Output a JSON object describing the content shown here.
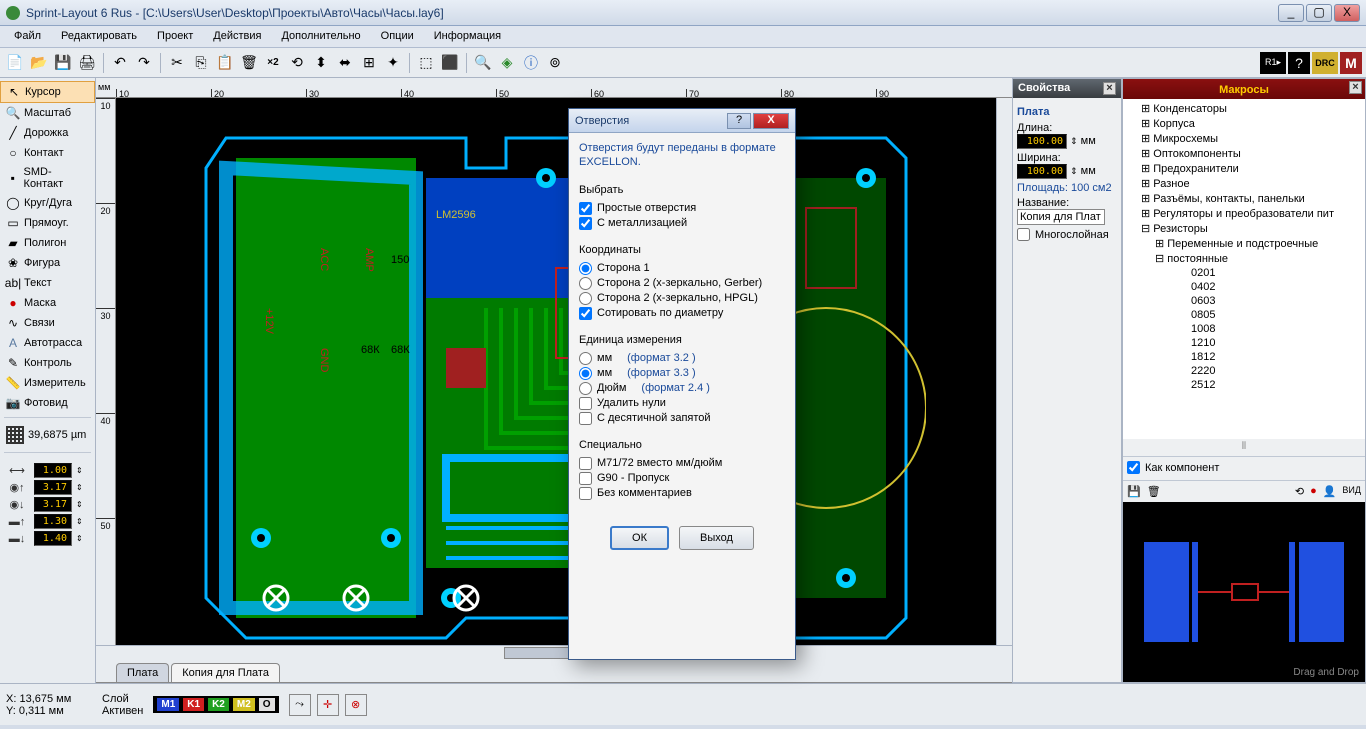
{
  "window": {
    "title": "Sprint-Layout 6 Rus - [C:\\Users\\User\\Desktop\\Проекты\\Авто\\Часы\\Часы.lay6]",
    "min": "_",
    "max": "▢",
    "close": "X"
  },
  "menu": [
    "Файл",
    "Редактировать",
    "Проект",
    "Действия",
    "Дополнительно",
    "Опции",
    "Информация"
  ],
  "tools_left": [
    {
      "icon": "↖",
      "label": "Курсор",
      "sel": true
    },
    {
      "icon": "🔍",
      "label": "Масштаб"
    },
    {
      "icon": "╱",
      "label": "Дорожка"
    },
    {
      "icon": "○",
      "label": "Контакт"
    },
    {
      "icon": "▪",
      "label": "SMD-Контакт"
    },
    {
      "icon": "◯",
      "label": "Круг/Дуга"
    },
    {
      "icon": "▭",
      "label": "Прямоуг."
    },
    {
      "icon": "▰",
      "label": "Полигон"
    },
    {
      "icon": "❀",
      "label": "Фигура"
    },
    {
      "icon": "ab|",
      "label": "Текст"
    },
    {
      "icon": "●",
      "label": "Маска",
      "color": "#c00"
    },
    {
      "icon": "∿",
      "label": "Связи"
    },
    {
      "icon": "A",
      "label": "Автотрасса",
      "color": "#5a7aa0"
    },
    {
      "icon": "✎",
      "label": "Контроль"
    },
    {
      "icon": "📏",
      "label": "Измеритель"
    },
    {
      "icon": "📷",
      "label": "Фотовид"
    }
  ],
  "grid_value": "39,6875 µm",
  "track_params": [
    {
      "icon": "⟷",
      "val": "1.00"
    },
    {
      "icon": "◉↑",
      "val": "3.17"
    },
    {
      "icon": "◉↓",
      "val": "3.17"
    },
    {
      "icon": "▬↑",
      "val": "1.30"
    },
    {
      "icon": "▬↓",
      "val": "1.40"
    }
  ],
  "ruler_h": {
    "unit": "мм",
    "ticks": [
      "10",
      "20",
      "30",
      "40",
      "50",
      "60",
      "70",
      "80",
      "90"
    ]
  },
  "ruler_v": {
    "ticks": [
      "10",
      "20",
      "30",
      "40",
      "50"
    ]
  },
  "canvas_tabs": [
    {
      "label": "Плата",
      "active": false
    },
    {
      "label": "Копия для Плата",
      "active": true
    }
  ],
  "properties": {
    "header": "Свойства",
    "section1": "Плата",
    "length_lbl": "Длина:",
    "length_val": "100.00",
    "length_unit": "мм",
    "width_lbl": "Ширина:",
    "width_val": "100.00",
    "width_unit": "мм",
    "area_lbl": "Площадь:",
    "area_val": "100 см2",
    "name_lbl": "Название:",
    "name_val": "Копия для Плат",
    "multilayer_lbl": "Многослойная"
  },
  "macros": {
    "header": "Макросы",
    "tree": [
      {
        "t": "⊞ Конденсаторы",
        "lvl": 1
      },
      {
        "t": "⊞ Корпуса",
        "lvl": 1
      },
      {
        "t": "⊞ Микросхемы",
        "lvl": 1
      },
      {
        "t": "⊞ Оптокомпоненты",
        "lvl": 1
      },
      {
        "t": "⊞ Предохранители",
        "lvl": 1
      },
      {
        "t": "⊞ Разное",
        "lvl": 1
      },
      {
        "t": "⊞ Разъёмы, контакты, панельки",
        "lvl": 1
      },
      {
        "t": "⊞ Регуляторы и преобразователи пит",
        "lvl": 1
      },
      {
        "t": "⊟ Резисторы",
        "lvl": 1,
        "open": true
      },
      {
        "t": "⊞ Переменные и подстроечные",
        "lvl": 2
      },
      {
        "t": "⊟ постоянные",
        "lvl": 2,
        "open": true
      },
      {
        "t": "0201",
        "lvl": 4
      },
      {
        "t": "0402",
        "lvl": 4
      },
      {
        "t": "0603",
        "lvl": 4
      },
      {
        "t": "0805",
        "lvl": 4
      },
      {
        "t": "1008",
        "lvl": 4
      },
      {
        "t": "1210",
        "lvl": 4
      },
      {
        "t": "1812",
        "lvl": 4
      },
      {
        "t": "2220",
        "lvl": 4
      },
      {
        "t": "2512",
        "lvl": 4
      }
    ],
    "as_component": "Как компонент",
    "view_label": "ВИД",
    "drag_drop": "Drag and Drop"
  },
  "dialog": {
    "title": "Отверстия",
    "info": "Отверстия будут переданы в формате EXCELLON.",
    "sec_select": "Выбрать",
    "chk_simple": "Простые отверстия",
    "chk_metal": "С металлизацией",
    "sec_coords": "Координаты",
    "rad_side1": "Сторона 1",
    "rad_side2g": "Сторона 2 (x-зеркально, Gerber)",
    "rad_side2h": "Сторона 2 (x-зеркально, HPGL)",
    "chk_sort": "Сотировать по диаметру",
    "sec_unit": "Единица измерения",
    "unit_mm1": "мм",
    "fmt1": "(формат 3.2 )",
    "unit_mm2": "мм",
    "fmt2": "(формат 3.3 )",
    "unit_inch": "Дюйм",
    "fmt3": "(формат 2.4 )",
    "chk_del_zero": "Удалить нули",
    "chk_decimal": "С десятичной запятой",
    "sec_special": "Специально",
    "chk_m71": "M71/72 вместо мм/дюйм",
    "chk_g90": "G90 - Пропуск",
    "chk_nocomm": "Без комментариев",
    "btn_ok": "ОК",
    "btn_exit": "Выход"
  },
  "status": {
    "x_lbl": "X:",
    "x_val": "13,675 мм",
    "y_lbl": "Y:",
    "y_val": "0,311 мм",
    "layer_lbl": "Слой",
    "active_lbl": "Активен",
    "layers": [
      {
        "name": "M1",
        "bg": "#2040d0"
      },
      {
        "name": "K1",
        "bg": "#d02020"
      },
      {
        "name": "K2",
        "bg": "#20a020"
      },
      {
        "name": "M2",
        "bg": "#d0c020"
      },
      {
        "name": "O",
        "bg": "#e0e0e0",
        "fg": "#000"
      }
    ]
  }
}
